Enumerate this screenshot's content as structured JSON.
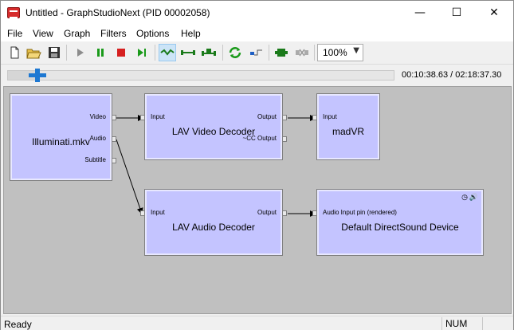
{
  "window": {
    "title": "Untitled - GraphStudioNext (PID 00002058)",
    "minimize_glyph": "—",
    "maximize_glyph": "☐",
    "close_glyph": "✕"
  },
  "menu": [
    "File",
    "View",
    "Graph",
    "Filters",
    "Options",
    "Help"
  ],
  "toolbar": {
    "icons": [
      "new-file-icon",
      "open-folder-icon",
      "save-icon",
      "play-icon",
      "pause-icon",
      "stop-icon",
      "step-icon",
      "connect-mode-icon",
      "direct-connect-icon",
      "smart-connect-icon",
      "refresh-icon",
      "seek-icon",
      "filter-icon",
      "disconnect-icon"
    ],
    "zoom": "100%"
  },
  "seek": {
    "time_display": "00:10:38.63 / 02:18:37.30",
    "position_fraction": 0.0766
  },
  "graph": {
    "source_filter": {
      "name": "Illuminati.mkv",
      "pins": [
        "Video",
        "Audio",
        "Subtitle"
      ]
    },
    "video_decoder": {
      "name": "LAV Video Decoder",
      "input_pin": "Input",
      "output_pins": [
        "Output",
        "~CC Output"
      ]
    },
    "video_renderer": {
      "name": "madVR",
      "input_pin": "Input"
    },
    "audio_decoder": {
      "name": "LAV Audio Decoder",
      "input_pin": "Input",
      "output_pin": "Output"
    },
    "audio_renderer": {
      "name": "Default DirectSound Device",
      "input_pin": "Audio Input pin (rendered)",
      "status_icons": [
        "clock-icon",
        "speaker-icon"
      ]
    }
  },
  "status": {
    "text": "Ready",
    "num": "NUM"
  },
  "colors": {
    "filter_fill": "#c4c4ff",
    "canvas": "#c0c0c0",
    "seek_accent": "#1e78d2",
    "play": "#808080",
    "pause": "#1a9a1a",
    "stop": "#d62020"
  }
}
